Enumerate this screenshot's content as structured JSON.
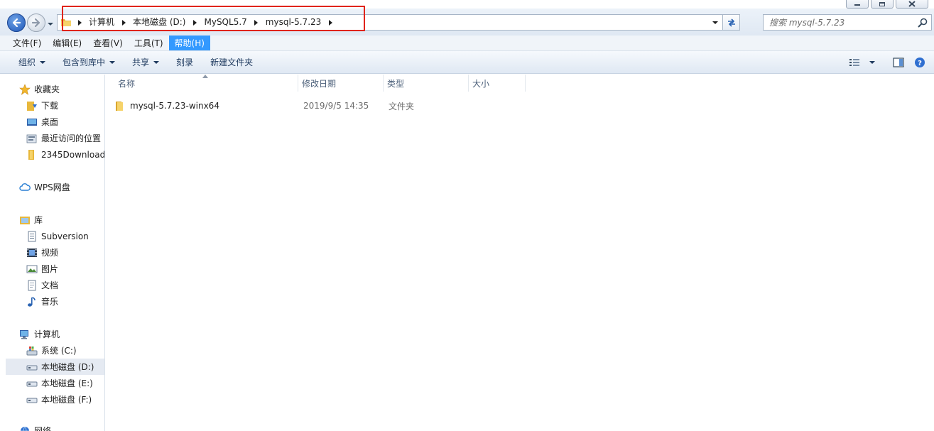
{
  "window": {
    "buttons": [
      "minimize",
      "maximize",
      "close"
    ]
  },
  "address": {
    "breadcrumbs": [
      "计算机",
      "本地磁盘 (D:)",
      "MySQL5.7",
      "mysql-5.7.23"
    ]
  },
  "search": {
    "placeholder": "搜索 mysql-5.7.23"
  },
  "menu": {
    "items": [
      "文件(F)",
      "编辑(E)",
      "查看(V)",
      "工具(T)",
      "帮助(H)"
    ],
    "active_index": 4
  },
  "commands": {
    "organize": "组织",
    "include_in_library": "包含到库中",
    "share": "共享",
    "burn": "刻录",
    "new_folder": "新建文件夹"
  },
  "nav": {
    "favorites": {
      "title": "收藏夹",
      "items": [
        "下载",
        "桌面",
        "最近访问的位置",
        "2345Download"
      ]
    },
    "wps": "WPS网盘",
    "libraries": {
      "title": "库",
      "items": [
        "Subversion",
        "视频",
        "图片",
        "文档",
        "音乐"
      ]
    },
    "computer": {
      "title": "计算机",
      "items": [
        "系统 (C:)",
        "本地磁盘 (D:)",
        "本地磁盘 (E:)",
        "本地磁盘 (F:)"
      ],
      "selected_index": 1
    },
    "network": "网络"
  },
  "columns": [
    "名称",
    "修改日期",
    "类型",
    "大小"
  ],
  "files": [
    {
      "name": "mysql-5.7.23-winx64",
      "modified": "2019/9/5 14:35",
      "type": "文件夹",
      "size": ""
    }
  ],
  "colors": {
    "accent": "#3399ff",
    "highlight_border": "#e0241b",
    "selected_nav": "#e5eaf2"
  }
}
